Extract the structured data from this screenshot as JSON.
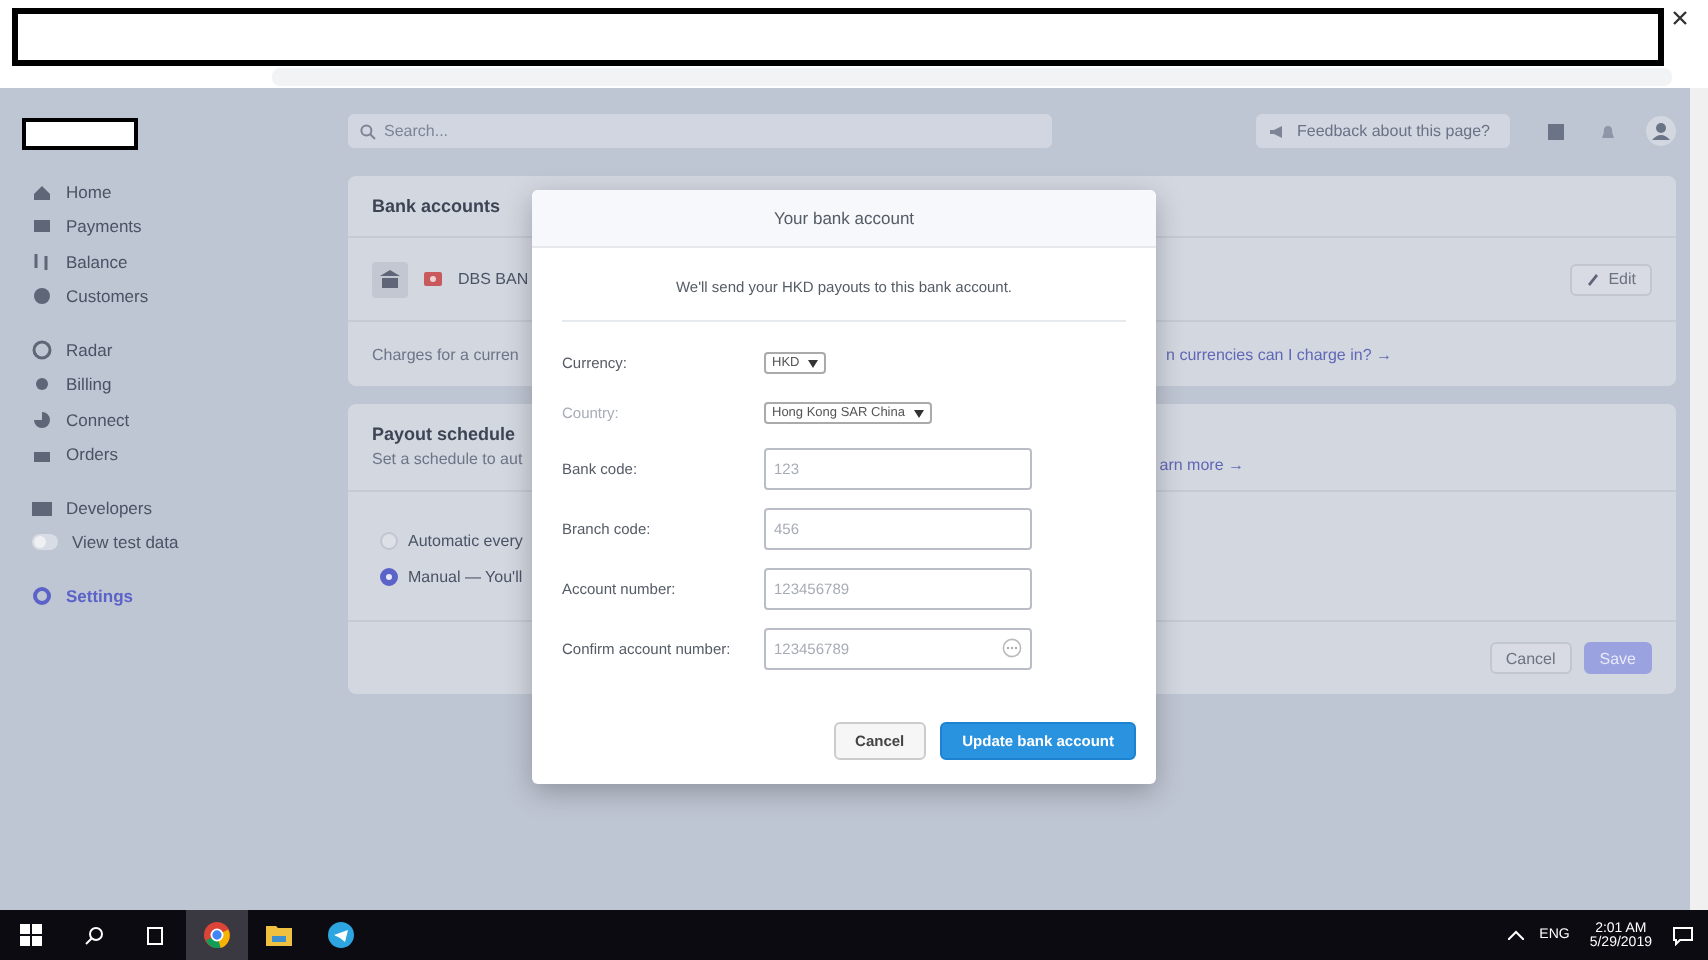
{
  "sidebar": {
    "items": [
      {
        "label": "Home",
        "selected": false
      },
      {
        "label": "Payments",
        "selected": false
      },
      {
        "label": "Balance",
        "selected": false
      },
      {
        "label": "Customers",
        "selected": false
      },
      {
        "label": "Radar",
        "selected": false
      },
      {
        "label": "Billing",
        "selected": false
      },
      {
        "label": "Connect",
        "selected": false
      },
      {
        "label": "Orders",
        "selected": false
      },
      {
        "label": "Developers",
        "selected": false
      },
      {
        "label": "Settings",
        "selected": true
      }
    ],
    "test_data": {
      "label": "View test data",
      "on": false
    }
  },
  "topbar": {
    "search": {
      "placeholder": "Search..."
    },
    "feedback": "Feedback about this page?"
  },
  "bank_accounts": {
    "title": "Bank accounts",
    "bank_name": "DBS BAN",
    "edit": "Edit",
    "note": "Charges for a curren",
    "link": "n currencies can I charge in? →"
  },
  "payout_schedule": {
    "title": "Payout schedule",
    "subtitle": "Set a schedule to aut",
    "link": "arn more →",
    "options": [
      {
        "label": "Automatic every",
        "selected": false
      },
      {
        "label": "Manual — You'll",
        "selected": true
      }
    ],
    "cancel": "Cancel",
    "save": "Save"
  },
  "modal": {
    "title": "Your bank account",
    "intro": "We'll send your HKD payouts to this bank account.",
    "fields": [
      {
        "kind": "select",
        "label": "Currency:",
        "value": "HKD",
        "disabled": false
      },
      {
        "kind": "select",
        "label": "Country:",
        "value": "Hong Kong SAR China",
        "disabled": true
      },
      {
        "kind": "input",
        "label": "Bank code:",
        "placeholder": "123"
      },
      {
        "kind": "input",
        "label": "Branch code:",
        "placeholder": "456"
      },
      {
        "kind": "input",
        "label": "Account number:",
        "placeholder": "123456789"
      },
      {
        "kind": "autofill",
        "label": "Confirm account number:",
        "placeholder": "123456789"
      }
    ],
    "cancel": "Cancel",
    "submit": "Update bank account"
  },
  "taskbar": {
    "apps": [
      {
        "selected": true
      },
      {
        "selected": false
      },
      {
        "selected": false
      }
    ],
    "language": "ENG",
    "time": "2:01 AM",
    "date": "5/29/2019"
  }
}
